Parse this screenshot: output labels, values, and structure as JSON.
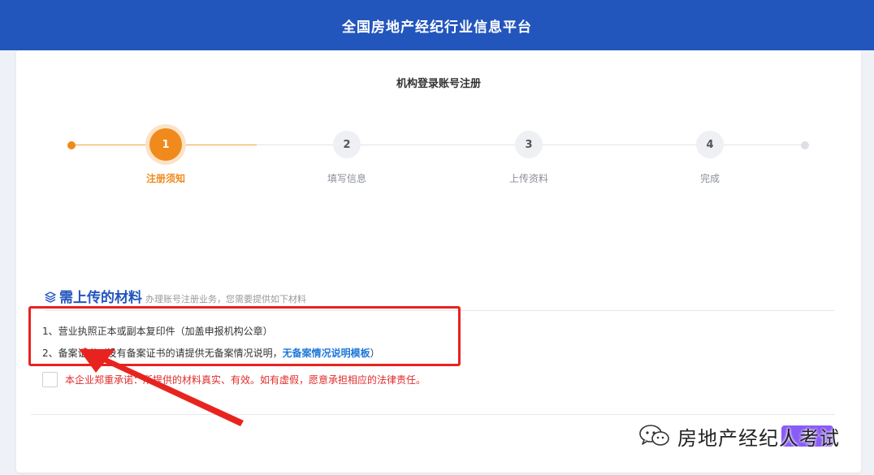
{
  "header": {
    "title": "全国房地产经纪行业信息平台"
  },
  "page": {
    "title": "机构登录账号注册"
  },
  "steps": [
    {
      "num": "1",
      "label": "注册须知",
      "state": "active"
    },
    {
      "num": "2",
      "label": "填写信息",
      "state": "pending"
    },
    {
      "num": "3",
      "label": "上传资料",
      "state": "pending"
    },
    {
      "num": "4",
      "label": "完成",
      "state": "pending"
    }
  ],
  "materials": {
    "heading": "需上传的材料",
    "subheading": "办理账号注册业务，您需要提供如下材料",
    "items": [
      {
        "text": "1、营业执照正本或副本复印件（加盖申报机构公章）"
      },
      {
        "prefix": "2、备案证书（没有备案证书的请提供无备案情况说明，",
        "link": "无备案情况说明模板",
        "suffix": "）"
      }
    ]
  },
  "promise": {
    "text": "本企业郑重承诺：所提供的材料真实、有效。如有虚假，愿意承担相应的法律责任。",
    "checked": false
  },
  "watermark": {
    "text": "房地产经纪人考试"
  },
  "colors": {
    "header": "#2356bd",
    "accent": "#f08a1c",
    "highlight": "#e8231f",
    "link": "#1e78d8"
  }
}
